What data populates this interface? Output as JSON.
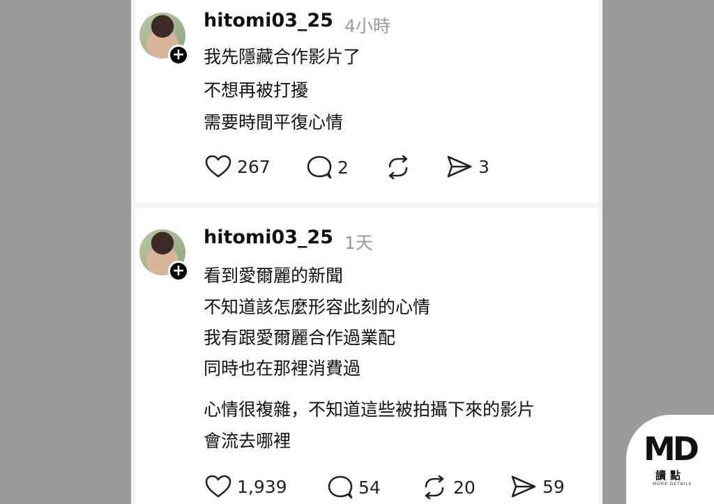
{
  "posts": [
    {
      "username": "hitomi03_25",
      "time": "4小時",
      "lines": [
        "我先隱藏合作影片了",
        "不想再被打擾",
        "需要時間平復心情"
      ],
      "likes": "267",
      "replies": "2",
      "reposts": "",
      "shares": "3"
    },
    {
      "username": "hitomi03_25",
      "time": "1天",
      "lines": [
        "看到愛爾麗的新聞",
        "不知道該怎麼形容此刻的心情",
        "我有跟愛爾麗合作過業配",
        "同時也在那裡消費過",
        "心情很複雜，不知道這些被拍攝下來的影片",
        "會流去哪裡"
      ],
      "likes": "1,939",
      "replies": "54",
      "reposts": "20",
      "shares": "59"
    }
  ],
  "logo": {
    "mark": "MD",
    "chinese": "讀點",
    "sub": "MORE DETAILS"
  },
  "icons": {
    "like": "heart-icon",
    "reply": "comment-icon",
    "repost": "repost-icon",
    "share": "send-icon",
    "follow": "plus-icon"
  }
}
